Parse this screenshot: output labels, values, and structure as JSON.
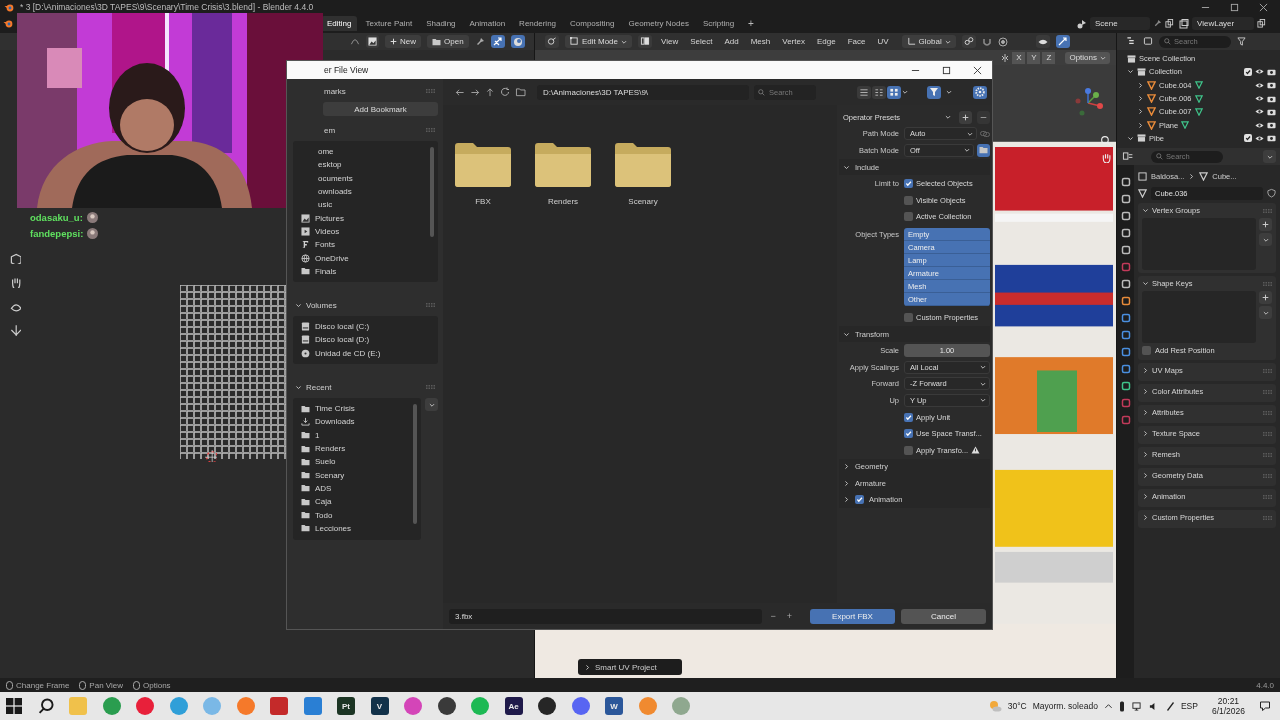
{
  "window": {
    "title": "* 3 [D:\\Animaciones\\3D TAPES\\9\\Scenary\\Time Crisis\\3.blend] - Blender 4.4.0"
  },
  "workspace_tabs": [
    {
      "label": "Editing",
      "selected": true
    },
    {
      "label": "Texture Paint",
      "selected": false
    },
    {
      "label": "Shading",
      "selected": false
    },
    {
      "label": "Animation",
      "selected": false
    },
    {
      "label": "Rendering",
      "selected": false
    },
    {
      "label": "Compositing",
      "selected": false
    },
    {
      "label": "Geometry Nodes",
      "selected": false
    },
    {
      "label": "Scripting",
      "selected": false
    }
  ],
  "add_workspace": "+",
  "scene": "Scene",
  "view_layer": "ViewLayer",
  "uv_header": {
    "new": "New",
    "open": "Open"
  },
  "viewport_header": {
    "mode": "Edit Mode",
    "menus": [
      "View",
      "Select",
      "Add",
      "Mesh",
      "Vertex",
      "Edge",
      "Face",
      "UV"
    ],
    "orientation": "Global",
    "axes": [
      "X",
      "Y",
      "Z"
    ],
    "options": "Options"
  },
  "last_operator": "Smart UV Project",
  "chat": [
    {
      "user": "odasaku_u:"
    },
    {
      "user": "fandepepsi:"
    }
  ],
  "outliner": {
    "search_placeholder": "Search",
    "tree": [
      {
        "name": "Scene Collection",
        "kind": "scene",
        "children": [
          {
            "name": "Collection",
            "kind": "collection",
            "expanded": true,
            "checked": true,
            "children": [
              {
                "name": "Cube.004",
                "kind": "mesh",
                "expanded": false
              },
              {
                "name": "Cube.006",
                "kind": "mesh",
                "expanded": false
              },
              {
                "name": "Cube.007",
                "kind": "mesh",
                "expanded": false
              },
              {
                "name": "Plane",
                "kind": "mesh",
                "expanded": false
              }
            ]
          },
          {
            "name": "Pibe",
            "kind": "collection",
            "expanded": true,
            "checked": true
          }
        ]
      }
    ]
  },
  "properties": {
    "search_placeholder": "Search",
    "breadcrumb": [
      "Baldosa...",
      "Cube..."
    ],
    "data_name": "Cube.036",
    "panels": [
      {
        "title": "Vertex Groups",
        "expanded": true,
        "kind": "list"
      },
      {
        "title": "Shape Keys",
        "expanded": true,
        "kind": "list",
        "option": {
          "label": "Add Rest Position",
          "checked": false
        }
      },
      {
        "title": "UV Maps",
        "expanded": false
      },
      {
        "title": "Color Attributes",
        "expanded": false
      },
      {
        "title": "Attributes",
        "expanded": false
      },
      {
        "title": "Texture Space",
        "expanded": false
      },
      {
        "title": "Remesh",
        "expanded": false
      },
      {
        "title": "Geometry Data",
        "expanded": false
      },
      {
        "title": "Animation",
        "expanded": false
      },
      {
        "title": "Custom Properties",
        "expanded": false
      }
    ]
  },
  "file_dialog": {
    "title": "er File View",
    "bookmarks": {
      "title": "marks",
      "add": "Add Bookmark"
    },
    "system": {
      "title": "em",
      "items": [
        {
          "label": "ome",
          "kind": "cut"
        },
        {
          "label": "esktop",
          "kind": "cut"
        },
        {
          "label": "ocuments",
          "kind": "cut"
        },
        {
          "label": "ownloads",
          "kind": "cut"
        },
        {
          "label": "usic",
          "kind": "cut"
        },
        {
          "label": "Pictures",
          "kind": "pictures"
        },
        {
          "label": "Videos",
          "kind": "videos"
        },
        {
          "label": "Fonts",
          "kind": "fonts"
        },
        {
          "label": "OneDrive",
          "kind": "cloud"
        },
        {
          "label": "Finals",
          "kind": "folder"
        }
      ]
    },
    "volumes": {
      "title": "Volumes",
      "expanded": true,
      "items": [
        {
          "label": "Disco local (C:)",
          "kind": "drive"
        },
        {
          "label": "Disco local (D:)",
          "kind": "drive"
        },
        {
          "label": "Unidad de CD (E:)",
          "kind": "disc"
        }
      ]
    },
    "recent": {
      "title": "Recent",
      "expanded": true,
      "items": [
        {
          "label": "Time Crisis",
          "kind": "folder"
        },
        {
          "label": "Downloads",
          "kind": "download"
        },
        {
          "label": "1",
          "kind": "folder"
        },
        {
          "label": "Renders",
          "kind": "folder"
        },
        {
          "label": "Suelo",
          "kind": "folder"
        },
        {
          "label": "Scenary",
          "kind": "folder"
        },
        {
          "label": "ADS",
          "kind": "folder"
        },
        {
          "label": "Caja",
          "kind": "folder"
        },
        {
          "label": "Todo",
          "kind": "folder"
        },
        {
          "label": "Lecciones",
          "kind": "folder"
        }
      ]
    },
    "path": "D:\\Animaciones\\3D TAPES\\9\\",
    "search_placeholder": "Search",
    "files": [
      {
        "name": "FBX"
      },
      {
        "name": "Renders"
      },
      {
        "name": "Scenary"
      }
    ],
    "filename": "3.fbx",
    "decrement": "−",
    "increment": "+",
    "export": "Export FBX",
    "cancel": "Cancel",
    "options": [
      {
        "kind": "presets",
        "label": "Operator Presets"
      },
      {
        "kind": "dropdown",
        "label": "Path Mode",
        "value": "Auto",
        "addon": {
          "kind": "link"
        }
      },
      {
        "kind": "dropdown",
        "label": "Batch Mode",
        "value": "Off",
        "addon": {
          "kind": "folder"
        }
      },
      {
        "kind": "section",
        "label": "Include",
        "expanded": true
      },
      {
        "kind": "checkbox",
        "label": "Limit to",
        "text": "Selected Objects",
        "checked": true
      },
      {
        "kind": "checkbox",
        "text": "Visible Objects",
        "checked": false
      },
      {
        "kind": "checkbox",
        "text": "Active Collection",
        "checked": false
      },
      {
        "kind": "multiselect",
        "label": "Object Types",
        "items": [
          {
            "label": "Empty",
            "selected": true
          },
          {
            "label": "Camera",
            "selected": true
          },
          {
            "label": "Lamp",
            "selected": true
          },
          {
            "label": "Armature",
            "selected": true
          },
          {
            "label": "Mesh",
            "selected": true
          },
          {
            "label": "Other",
            "selected": true
          }
        ]
      },
      {
        "kind": "checkbox",
        "text": "Custom Properties",
        "checked": false
      },
      {
        "kind": "section",
        "label": "Transform",
        "expanded": true
      },
      {
        "kind": "number",
        "label": "Scale",
        "value": "1.00"
      },
      {
        "kind": "dropdown",
        "label": "Apply Scalings",
        "value": "All Local"
      },
      {
        "kind": "dropdown",
        "label": "Forward",
        "value": "-Z Forward"
      },
      {
        "kind": "dropdown",
        "label": "Up",
        "value": "Y Up"
      },
      {
        "kind": "checkbox",
        "text": "Apply Unit",
        "checked": true
      },
      {
        "kind": "checkbox",
        "text": "Use Space Transf...",
        "checked": true
      },
      {
        "kind": "checkbox",
        "text": "Apply Transfo...",
        "checked": false,
        "warning": true
      },
      {
        "kind": "section",
        "label": "Geometry",
        "expanded": false
      },
      {
        "kind": "section",
        "label": "Armature",
        "expanded": false
      },
      {
        "kind": "section",
        "label": "Animation",
        "expanded": false,
        "checked": true
      }
    ]
  },
  "status_bar": {
    "hints": [
      "Change Frame",
      "Pan View",
      "Options"
    ],
    "version": "4.4.0"
  },
  "taskbar": {
    "apps": [
      {
        "kind": "start"
      },
      {
        "kind": "search"
      },
      {
        "kind": "tile",
        "color": "#f0c14b"
      },
      {
        "kind": "round",
        "color": "#2a9d4f"
      },
      {
        "kind": "round",
        "color": "#e8203a"
      },
      {
        "kind": "round",
        "color": "#2f9fd8"
      },
      {
        "kind": "round",
        "color": "#7ab8e6"
      },
      {
        "kind": "round",
        "color": "#f5792a"
      },
      {
        "kind": "tile",
        "color": "#c42a2a"
      },
      {
        "kind": "tile",
        "color": "#2a7fd4"
      },
      {
        "kind": "tile",
        "label": "Pt",
        "color": "#1c3524"
      },
      {
        "kind": "tile",
        "label": "V",
        "color": "#12324a"
      },
      {
        "kind": "round",
        "color": "#d445b8"
      },
      {
        "kind": "round",
        "color": "#3a3a3a"
      },
      {
        "kind": "round",
        "color": "#1db954"
      },
      {
        "kind": "tile",
        "label": "Ae",
        "color": "#1f1a4a"
      },
      {
        "kind": "round",
        "color": "#262626"
      },
      {
        "kind": "round",
        "color": "#5865f2"
      },
      {
        "kind": "tile",
        "label": "W",
        "color": "#2b579a"
      },
      {
        "kind": "round",
        "color": "#f08a30"
      },
      {
        "kind": "round",
        "color": "#8fa88f"
      }
    ],
    "temperature": "30°C",
    "forecast": "Mayorm. soleado",
    "language": "ESP",
    "time": "20:21",
    "date": "6/1/2026"
  }
}
